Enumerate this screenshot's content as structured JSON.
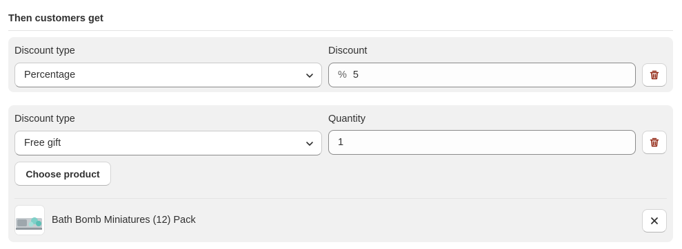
{
  "section_title": "Then customers get",
  "rows": [
    {
      "type_label": "Discount type",
      "type_value": "Percentage",
      "value_label": "Discount",
      "value_prefix": "%",
      "value": "5"
    },
    {
      "type_label": "Discount type",
      "type_value": "Free gift",
      "value_label": "Quantity",
      "value": "1",
      "choose_button": "Choose product",
      "product": {
        "name": "Bath Bomb Miniatures (12) Pack"
      }
    }
  ],
  "icons": {
    "delete": "trash-icon",
    "remove": "close-icon",
    "dropdown": "chevron-down-icon"
  },
  "colors": {
    "delete_icon": "#8e1f0b",
    "panel_bg": "#f1f1f1",
    "text": "#303030"
  }
}
